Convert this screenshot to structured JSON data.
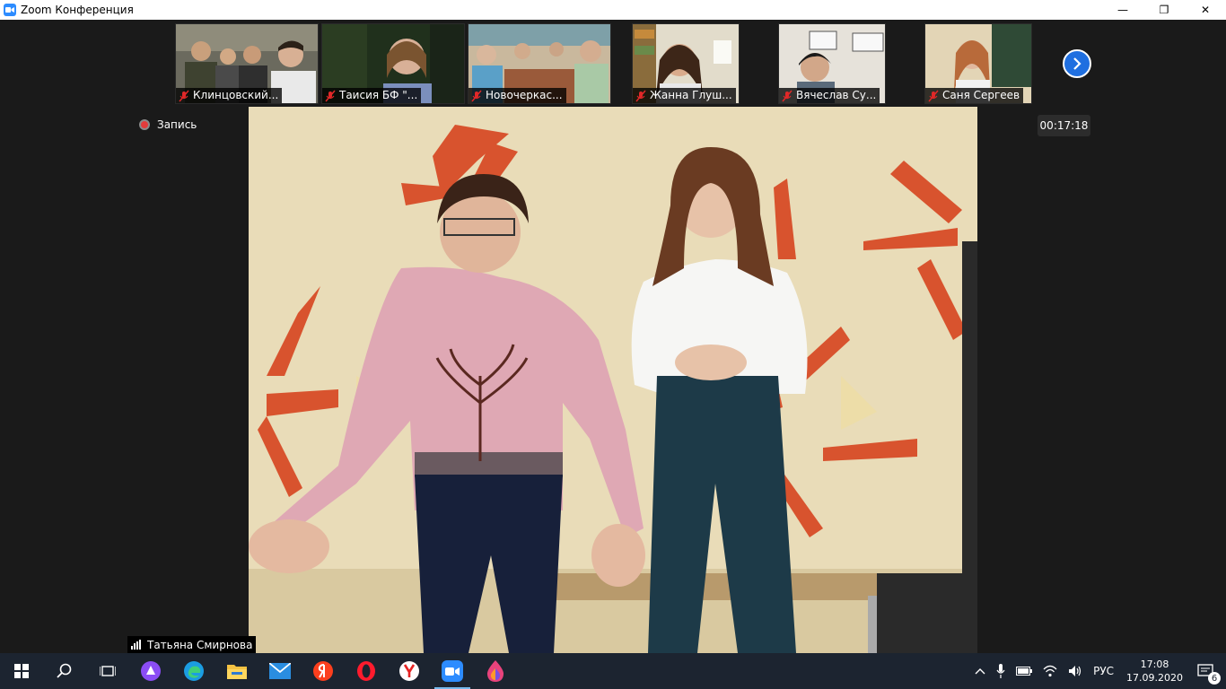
{
  "window": {
    "title": "Zoom Конференция",
    "minimize_glyph": "—",
    "restore_glyph": "❐",
    "close_glyph": "✕"
  },
  "participants": [
    {
      "name": "Клинцовский...",
      "muted": true
    },
    {
      "name": "Таисия БФ \"...",
      "muted": true
    },
    {
      "name": "Новочеркас...",
      "muted": true
    },
    {
      "name": "Жанна Глуш...",
      "muted": true
    },
    {
      "name": "Вячеслав Су...",
      "muted": true
    },
    {
      "name": "Саня Сергеев",
      "muted": true
    }
  ],
  "recording": {
    "label": "Запись"
  },
  "timer": {
    "value": "00:17:18"
  },
  "speaker": {
    "name": "Татьяна Смирнова"
  },
  "taskbar": {
    "apps": [
      "start-icon",
      "search-icon",
      "task-view-icon",
      "alice-icon",
      "edge-icon",
      "file-explorer-icon",
      "mail-icon",
      "yandex-icon",
      "opera-icon",
      "yandex-browser-icon",
      "zoom-icon",
      "paint-icon"
    ],
    "active_app": "zoom-icon",
    "language": "РУС",
    "time": "17:08",
    "date": "17.09.2020",
    "notifications": "6"
  },
  "colors": {
    "accent": "#2d8cff",
    "next_button": "#1f6fe0",
    "recording": "#e23b3b",
    "taskbar": "#1c2430"
  }
}
